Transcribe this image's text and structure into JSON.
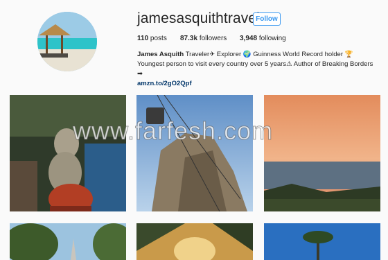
{
  "profile": {
    "username": "jamesasquithtravel",
    "follow_label": "Follow",
    "stats": {
      "posts_count": "110",
      "posts_label": "posts",
      "followers_count": "87.3k",
      "followers_label": "followers",
      "following_count": "3,948",
      "following_label": "following"
    },
    "bio": {
      "name": "James Asquith",
      "text": " Traveler✈ Explorer 🌍 Guinness World Record holder 🏆 Youngest person to visit every country over 5 years⚠ Author of Breaking Borders ➡",
      "link": "amzn.to/2gO2Qpf"
    }
  },
  "posts": [
    {
      "subject": "monkey on statue"
    },
    {
      "subject": "cable car over mountain"
    },
    {
      "subject": "sunset over sea"
    },
    {
      "subject": "tropical tree and temple"
    },
    {
      "subject": "palm trees at sunrise"
    },
    {
      "subject": "palm tree and blue sky"
    }
  ],
  "watermark": "www.farfesh.com"
}
